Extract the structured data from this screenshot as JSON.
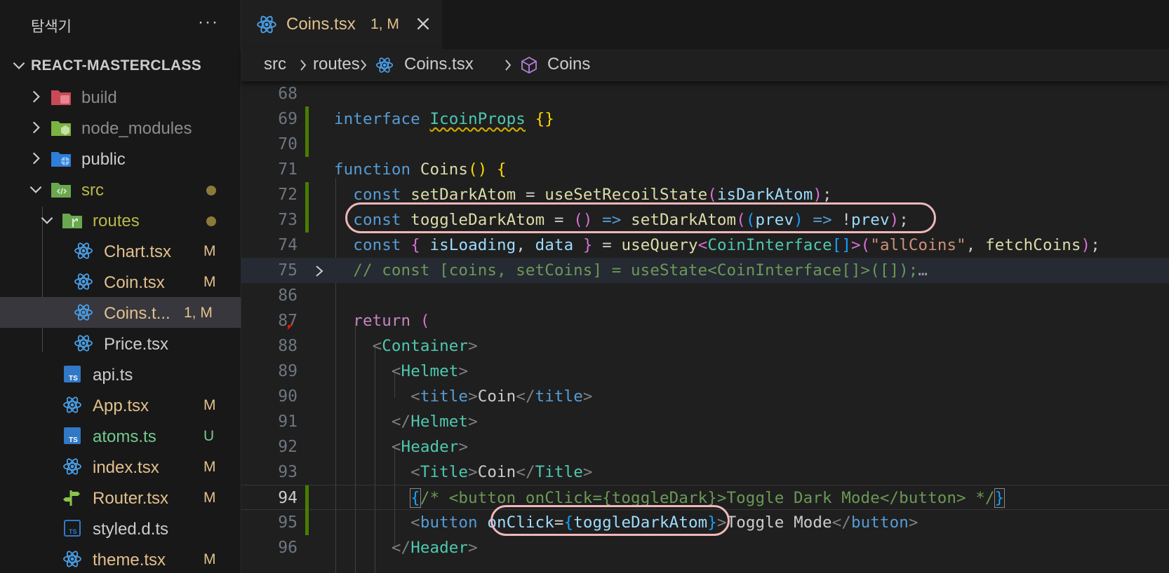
{
  "sidebar": {
    "title": "탐색기",
    "more_label": "···",
    "project": "REACT-MASTERCLASS",
    "items": [
      {
        "label": "build",
        "icon": "build-folder-icon",
        "badge": "",
        "status": "ignored"
      },
      {
        "label": "node_modules",
        "icon": "node-folder-icon",
        "badge": "",
        "status": "ignored"
      },
      {
        "label": "public",
        "icon": "public-folder-icon",
        "badge": "",
        "status": ""
      },
      {
        "label": "src",
        "icon": "src-folder-icon",
        "badge": "",
        "status": "modified-dot"
      },
      {
        "label": "routes",
        "icon": "routes-folder-icon",
        "badge": "",
        "status": "modified-dot"
      },
      {
        "label": "Chart.tsx",
        "icon": "react-icon",
        "badge": "M",
        "status": "modified"
      },
      {
        "label": "Coin.tsx",
        "icon": "react-icon",
        "badge": "M",
        "status": "modified"
      },
      {
        "label": "Coins.t...",
        "icon": "react-icon",
        "badge": "1, M",
        "status": "modified-selected"
      },
      {
        "label": "Price.tsx",
        "icon": "react-icon",
        "badge": "",
        "status": ""
      },
      {
        "label": "api.ts",
        "icon": "typescript-icon",
        "badge": "",
        "status": ""
      },
      {
        "label": "App.tsx",
        "icon": "react-icon",
        "badge": "M",
        "status": "modified"
      },
      {
        "label": "atoms.ts",
        "icon": "typescript-icon",
        "badge": "U",
        "status": "untracked"
      },
      {
        "label": "index.tsx",
        "icon": "react-icon",
        "badge": "M",
        "status": "modified"
      },
      {
        "label": "Router.tsx",
        "icon": "router-icon",
        "badge": "M",
        "status": "modified"
      },
      {
        "label": "styled.d.ts",
        "icon": "typescript-def-icon",
        "badge": "",
        "status": ""
      },
      {
        "label": "theme.tsx",
        "icon": "react-icon",
        "badge": "M",
        "status": "modified"
      }
    ]
  },
  "tab": {
    "name": "Coins.tsx",
    "status": "1, M",
    "close_icon": "close-icon"
  },
  "breadcrumb": [
    "src",
    "routes",
    "Coins.tsx",
    "Coins"
  ],
  "editor": {
    "lines": [
      {
        "n": "68",
        "text": ""
      },
      {
        "n": "69",
        "text": "interface IcoinProps {}"
      },
      {
        "n": "70",
        "text": ""
      },
      {
        "n": "71",
        "text": "function Coins() {"
      },
      {
        "n": "72",
        "text": "  const setDarkAtom = useSetRecoilState(isDarkAtom);"
      },
      {
        "n": "73",
        "text": "  const toggleDarkAtom = () => setDarkAtom((prev) => !prev);"
      },
      {
        "n": "74",
        "text": "  const { isLoading, data } = useQuery<CoinInterface[]>(\"allCoins\", fetchCoins);"
      },
      {
        "n": "75",
        "text": "  // const [coins, setCoins] = useState<CoinInterface[]>([]);"
      },
      {
        "n": "86",
        "text": ""
      },
      {
        "n": "87",
        "text": "  return ("
      },
      {
        "n": "88",
        "text": "    <Container>"
      },
      {
        "n": "89",
        "text": "      <Helmet>"
      },
      {
        "n": "90",
        "text": "        <title>Coin</title>"
      },
      {
        "n": "91",
        "text": "      </Helmet>"
      },
      {
        "n": "92",
        "text": "      <Header>"
      },
      {
        "n": "93",
        "text": "        <Title>Coin</Title>"
      },
      {
        "n": "94",
        "text": "        {/* <button onClick={toggleDark}>Toggle Dark Mode</button> */}"
      },
      {
        "n": "95",
        "text": "        <button onClick={toggleDarkAtom}>Toggle Mode</button>"
      },
      {
        "n": "96",
        "text": "      </Header>"
      }
    ],
    "folded_ellipsis": "…"
  },
  "colors": {
    "modified_file": "#e2c08d",
    "untracked_file": "#73c991",
    "annotation_outline": "#f0b7b9",
    "gutter_modified": "#487e02"
  }
}
